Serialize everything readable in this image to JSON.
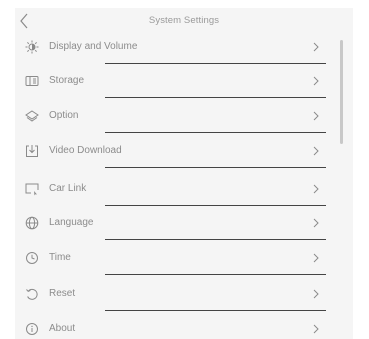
{
  "header": {
    "title": "System Settings",
    "back_icon": "chevron-left-icon"
  },
  "items": [
    {
      "label": "Display and Volume",
      "icon": "brightness-icon"
    },
    {
      "label": "Storage",
      "icon": "storage-icon"
    },
    {
      "label": "Option",
      "icon": "layers-icon"
    },
    {
      "label": "Video Download",
      "icon": "download-icon"
    },
    {
      "label": "Car Link",
      "icon": "monitor-link-icon"
    },
    {
      "label": "Language",
      "icon": "globe-icon"
    },
    {
      "label": "Time",
      "icon": "clock-icon"
    },
    {
      "label": "Reset",
      "icon": "reset-icon"
    },
    {
      "label": "About",
      "icon": "info-icon"
    }
  ],
  "colors": {
    "background": "#f5f5f5",
    "text": "#8c8c8c",
    "divider": "#444444",
    "scrollbar": "#c8c8c8"
  }
}
